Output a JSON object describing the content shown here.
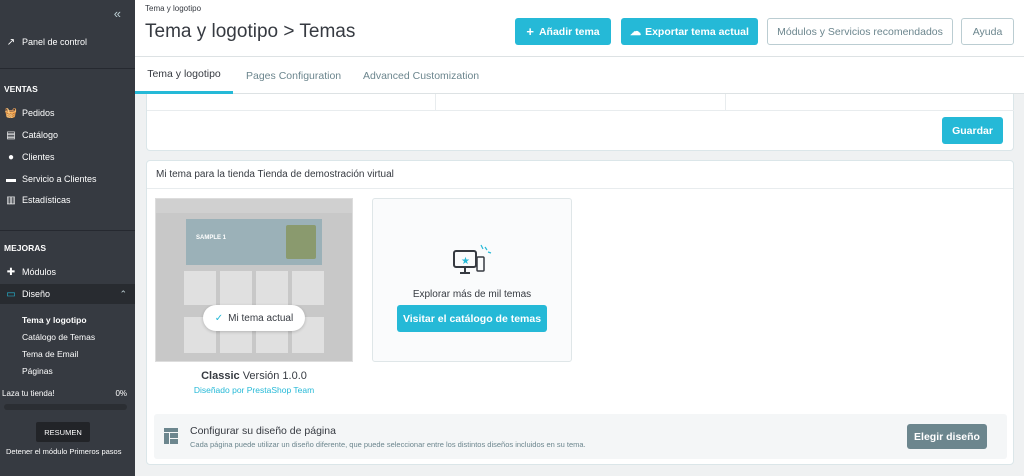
{
  "sidebar": {
    "collapse_icon": "double-chevron-left",
    "dashboard": "Panel de control",
    "sections": {
      "sales": "VENTAS",
      "improve": "MEJORAS"
    },
    "sales_items": [
      {
        "label": "Pedidos",
        "icon": "shopping-basket-icon"
      },
      {
        "label": "Catálogo",
        "icon": "store-icon"
      },
      {
        "label": "Clientes",
        "icon": "user-icon"
      },
      {
        "label": "Servicio a Clientes",
        "icon": "chat-icon"
      },
      {
        "label": "Estadísticas",
        "icon": "bar-chart-icon"
      }
    ],
    "improve_items": [
      {
        "label": "Módulos",
        "icon": "puzzle-icon"
      },
      {
        "label": "Diseño",
        "icon": "monitor-icon"
      }
    ],
    "design_sub": [
      "Tema y logotipo",
      "Catálogo de Temas",
      "Tema de Email",
      "Páginas"
    ],
    "onboarding": {
      "label": "Laza tu tienda!",
      "percent": "0%",
      "progress": 0,
      "resume": "RESUMEN",
      "stop": "Detener el módulo Primeros pasos"
    }
  },
  "header": {
    "breadcrumb": "Tema y logotipo",
    "title": "Tema y logotipo > Temas",
    "add_theme": "Añadir tema",
    "export_theme": "Exportar tema actual",
    "modules_services": "Módulos y Servicios recomendados",
    "help": "Ayuda"
  },
  "tabs": [
    "Tema y logotipo",
    "Pages Configuration",
    "Advanced Customization"
  ],
  "top_card": {
    "save": "Guardar"
  },
  "theme_card": {
    "title": "Mi tema para la tienda Tienda de demostración virtual",
    "current_label": "Mi tema actual",
    "theme_name": "Classic",
    "version": "Versión 1.0.0",
    "designer": "Diseñado por PrestaShop Team",
    "preview_banner": "SAMPLE 1",
    "explore_text": "Explorar más de mil temas",
    "visit_catalog": "Visitar el catálogo de temas",
    "layout_title": "Configurar su diseño de página",
    "layout_desc": "Cada página puede utilizar un diseño diferente, que puede seleccionar entre los distintos diseños incluidos en su tema.",
    "choose_layout": "Elegir diseño"
  },
  "colors": {
    "accent": "#25b9d7",
    "sidebar": "#363a41",
    "secondary_btn": "#6c868e"
  }
}
